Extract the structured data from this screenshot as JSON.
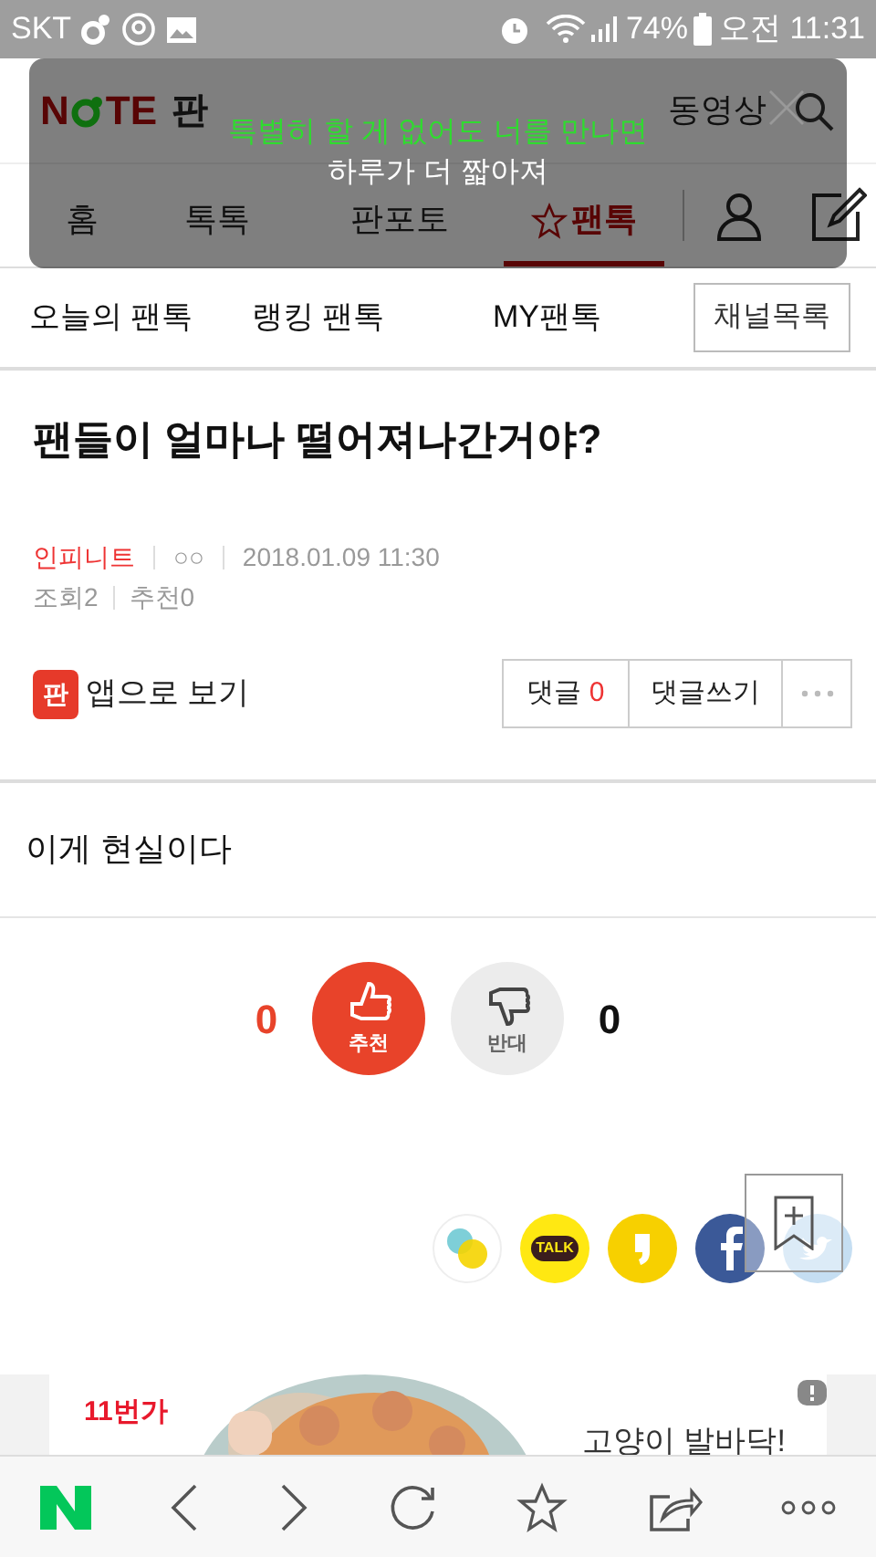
{
  "status_bar": {
    "carrier": "SKT",
    "battery": "74%",
    "time": "오전 11:31"
  },
  "header": {
    "logo_left": "N",
    "logo_right": "TE",
    "section": "판",
    "video": "동영상"
  },
  "tabs": [
    {
      "label": "홈",
      "selected": false
    },
    {
      "label": "톡톡",
      "selected": false
    },
    {
      "label": "판포토",
      "selected": false
    },
    {
      "label": "팬톡",
      "selected": true
    }
  ],
  "notification": {
    "line_1": "특별히 할 게 없어도 너를 만나면",
    "line_2": "하루가 더 짧아져"
  },
  "subnav": {
    "items": [
      "오늘의 팬톡",
      "랭킹 팬톡",
      "MY팬톡"
    ],
    "button": "채널목록"
  },
  "post": {
    "title": "팬들이 얼마나 떨어져나간거야?",
    "channel": "인피니트",
    "author": "○○",
    "date": "2018.01.09 11:30",
    "views": "조회2",
    "recommends": "추천0",
    "app_view": "앱으로 보기",
    "app_icon": "판",
    "comments_label": "댓글",
    "comments_count": "0",
    "write_comment": "댓글쓰기",
    "body": "이게 현실이다"
  },
  "vote": {
    "up_count": "0",
    "up_label": "추천",
    "down_label": "반대",
    "down_count": "0"
  },
  "share": {
    "talk": "TALK"
  },
  "ad": {
    "brand": "11번가",
    "text": "고양이 발바닥!"
  }
}
